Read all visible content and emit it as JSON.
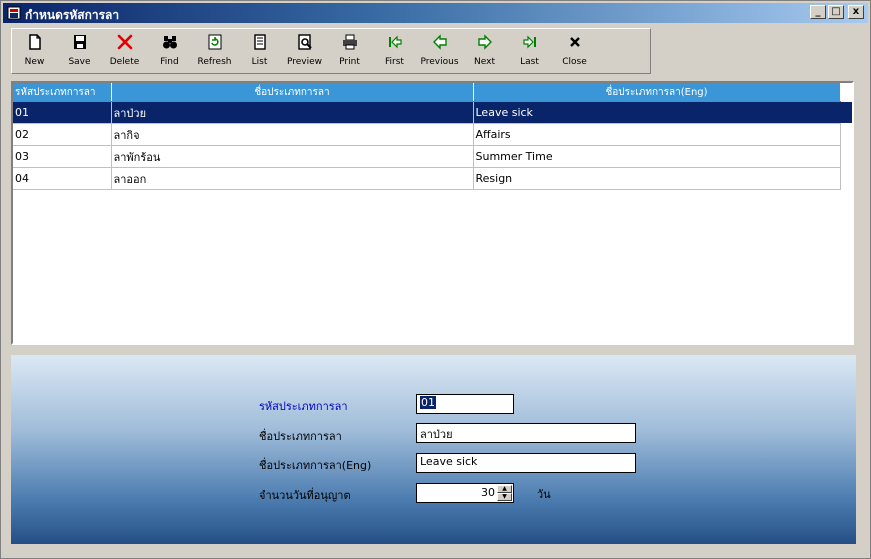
{
  "window": {
    "title": "กำหนดรหัสการลา",
    "controls": {
      "minimize": "_",
      "maximize": "□",
      "close": "x"
    }
  },
  "toolbar": {
    "buttons": [
      {
        "id": "new",
        "label": "New",
        "icon": "new-page-icon"
      },
      {
        "id": "save",
        "label": "Save",
        "icon": "floppy-disk-icon"
      },
      {
        "id": "delete",
        "label": "Delete",
        "icon": "red-x-icon"
      },
      {
        "id": "find",
        "label": "Find",
        "icon": "binoculars-icon"
      },
      {
        "id": "refresh",
        "label": "Refresh",
        "icon": "refresh-icon"
      },
      {
        "id": "list",
        "label": "List",
        "icon": "list-document-icon"
      },
      {
        "id": "preview",
        "label": "Preview",
        "icon": "print-preview-icon"
      },
      {
        "id": "print",
        "label": "Print",
        "icon": "printer-icon"
      },
      {
        "id": "first",
        "label": "First",
        "icon": "first-record-icon"
      },
      {
        "id": "previous",
        "label": "Previous",
        "icon": "previous-arrow-icon"
      },
      {
        "id": "next",
        "label": "Next",
        "icon": "next-arrow-icon"
      },
      {
        "id": "last",
        "label": "Last",
        "icon": "last-record-icon"
      },
      {
        "id": "close",
        "label": "Close",
        "icon": "close-x-icon"
      }
    ]
  },
  "grid": {
    "headers": [
      "รหัสประเภทการลา",
      "ชื่อประเภทการลา",
      "ชื่อประเภทการลา(Eng)"
    ],
    "rows": [
      {
        "code": "01",
        "name": "ลาป่วย",
        "name_eng": "Leave sick"
      },
      {
        "code": "02",
        "name": "ลากิจ",
        "name_eng": "Affairs"
      },
      {
        "code": "03",
        "name": "ลาพักร้อน",
        "name_eng": "Summer Time"
      },
      {
        "code": "04",
        "name": "ลาออก",
        "name_eng": "Resign"
      }
    ],
    "selected_row": 0
  },
  "form": {
    "code_label": "รหัสประเภทการลา",
    "code_value": "01",
    "name_label": "ชื่อประเภทการลา",
    "name_value": "ลาป่วย",
    "name_eng_label": "ชื่อประเภทการลา(Eng)",
    "name_eng_value": "Leave sick",
    "days_label": "จำนวนวันที่อนุญาต",
    "days_value": "30",
    "days_unit": "วัน"
  },
  "colors": {
    "title_bar": "#0a246a",
    "grid_header": "#3a96d6",
    "selection": "#0a246a",
    "highlight_label": "#0000c0"
  }
}
